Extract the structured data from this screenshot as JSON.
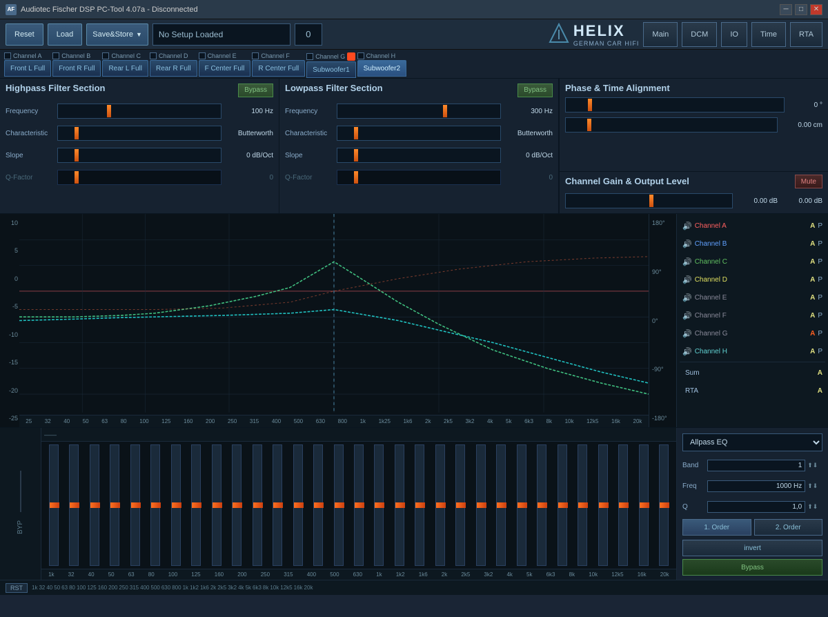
{
  "titlebar": {
    "title": "Audiotec Fischer DSP PC-Tool 4.07a - Disconnected",
    "icon": "AF"
  },
  "toolbar": {
    "reset_label": "Reset",
    "load_label": "Load",
    "save_store_label": "Save&Store",
    "setup_name": "No Setup Loaded",
    "setup_num": "0",
    "nav": {
      "main": "Main",
      "dcm": "DCM",
      "io": "IO",
      "time": "Time",
      "rta": "RTA"
    },
    "logo_main": "HELIX",
    "logo_sub": "GERMAN CAR HIFI"
  },
  "channels": [
    {
      "label": "Channel A",
      "tab": "Front L Full",
      "active": false
    },
    {
      "label": "Channel B",
      "tab": "Front R Full",
      "active": false
    },
    {
      "label": "Channel C",
      "tab": "Rear L Full",
      "active": false
    },
    {
      "label": "Channel D",
      "tab": "Rear R Full",
      "active": false
    },
    {
      "label": "Channel E",
      "tab": "F Center Full",
      "active": false
    },
    {
      "label": "Channel F",
      "tab": "R Center Full",
      "active": false
    },
    {
      "label": "Channel G",
      "tab": "Subwoofer1",
      "active": false
    },
    {
      "label": "Channel H",
      "tab": "Subwoofer2",
      "active": true
    }
  ],
  "highpass": {
    "title": "Highpass Filter Section",
    "bypass": "Bypass",
    "frequency_label": "Frequency",
    "frequency_value": "100 Hz",
    "characteristic_label": "Characteristic",
    "characteristic_value": "Butterworth",
    "slope_label": "Slope",
    "slope_value": "0 dB/Oct",
    "qfactor_label": "Q-Factor",
    "qfactor_value": "0"
  },
  "lowpass": {
    "title": "Lowpass Filter Section",
    "bypass": "Bypass",
    "frequency_label": "Frequency",
    "frequency_value": "300 Hz",
    "characteristic_label": "Characteristic",
    "characteristic_value": "Butterworth",
    "slope_label": "Slope",
    "slope_value": "0 dB/Oct",
    "qfactor_label": "Q-Factor",
    "qfactor_value": "0"
  },
  "phase": {
    "title": "Phase & Time Alignment",
    "phase_value": "0 °",
    "time_value": "0.00 cm"
  },
  "gain": {
    "title": "Channel Gain & Output Level",
    "mute": "Mute",
    "gain_value": "0.00 dB",
    "output_value": "0.00 dB"
  },
  "chart": {
    "y_labels": [
      "10",
      "5",
      "0",
      "-5",
      "-10",
      "-15",
      "-20",
      "-25"
    ],
    "y_right_labels": [
      "180°",
      "90°",
      "0°",
      "-90°",
      "-180°"
    ],
    "x_labels": [
      "25",
      "32",
      "40",
      "50",
      "63",
      "80",
      "100",
      "125",
      "160",
      "200",
      "250",
      "315",
      "400",
      "500",
      "630",
      "800",
      "1k",
      "1k25",
      "1k6",
      "2k",
      "2k5",
      "3k2",
      "4k",
      "5k",
      "6k3",
      "8k",
      "10k",
      "12k5",
      "16k",
      "20k"
    ]
  },
  "channel_list": [
    {
      "name": "Channel A",
      "color": "ch-a",
      "ap": "A",
      "p": "P"
    },
    {
      "name": "Channel B",
      "color": "ch-b",
      "ap": "A",
      "p": "P"
    },
    {
      "name": "Channel C",
      "color": "ch-c",
      "ap": "A",
      "p": "P"
    },
    {
      "name": "Channel D",
      "color": "ch-d",
      "ap": "A",
      "p": "P"
    },
    {
      "name": "Channel E",
      "color": "ch-e",
      "ap": "A",
      "p": "P"
    },
    {
      "name": "Channel F",
      "color": "ch-f",
      "ap": "A",
      "p": "P"
    },
    {
      "name": "Channel G",
      "color": "ch-g",
      "ap": "A",
      "p": "P",
      "a_highlight": true
    },
    {
      "name": "Channel H",
      "color": "ch-h",
      "ap": "A",
      "p": "P"
    }
  ],
  "eq": {
    "type": "Allpass EQ",
    "band_label": "Band",
    "band_value": "1",
    "freq_label": "Freq",
    "freq_value": "1000 Hz",
    "q_label": "Q",
    "q_value": "1,0",
    "order1": "1. Order",
    "order2": "2. Order",
    "invert": "invert",
    "bypass": "Bypass",
    "byp": "BYP"
  },
  "eq_x_labels": [
    "1k",
    "32",
    "40",
    "50",
    "63",
    "80",
    "100",
    "125",
    "160",
    "200",
    "250",
    "315",
    "400",
    "500",
    "630",
    "800",
    "1k",
    "1k2",
    "1k6",
    "2k",
    "2k5",
    "3k2",
    "4k",
    "5k",
    "6k3",
    "8k",
    "10k",
    "12k5",
    "16k",
    "20k"
  ],
  "status_labels": [
    "1k",
    "32",
    "40",
    "50",
    "63",
    "80",
    "100",
    "125",
    "160",
    "200",
    "250",
    "315",
    "400",
    "500",
    "630",
    "800",
    "1k",
    "1k2",
    "1k6",
    "2k",
    "2k5",
    "3k2",
    "4k",
    "5k",
    "6k3",
    "8k",
    "10k",
    "12k5",
    "16k",
    "20k"
  ]
}
